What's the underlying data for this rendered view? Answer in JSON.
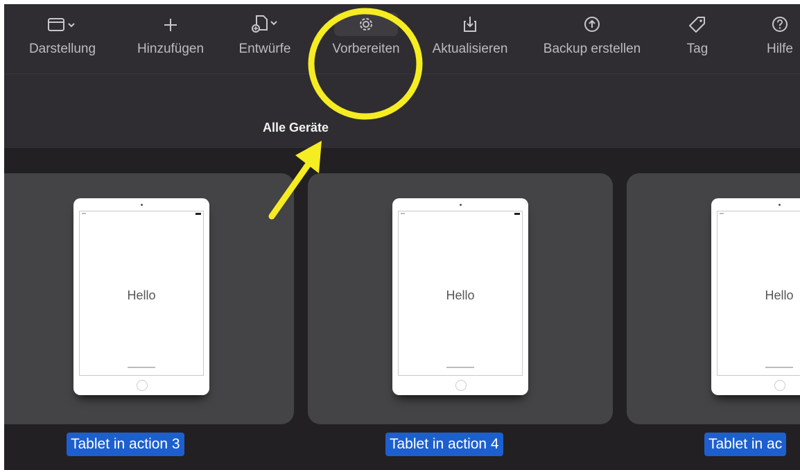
{
  "toolbar": {
    "items": [
      {
        "label": "Darstellung",
        "icon": "window-icon",
        "chevron": true
      },
      {
        "label": "Hinzufügen",
        "icon": "plus-icon",
        "chevron": false
      },
      {
        "label": "Entwürfe",
        "icon": "document-add-icon",
        "chevron": true
      },
      {
        "label": "Vorbereiten",
        "icon": "gear-icon",
        "chevron": false,
        "active": true
      },
      {
        "label": "Aktualisieren",
        "icon": "download-tray-icon",
        "chevron": false
      },
      {
        "label": "Backup erstellen",
        "icon": "upload-circle-icon",
        "chevron": false
      },
      {
        "label": "Tag",
        "icon": "tag-icon",
        "chevron": false
      },
      {
        "label": "Hilfe",
        "icon": "help-circle-icon",
        "chevron": false
      }
    ]
  },
  "section": {
    "title": "Alle Geräte"
  },
  "devices": [
    {
      "label": "Tablet in action 3",
      "screen_text": "Hello"
    },
    {
      "label": "Tablet in action 4",
      "screen_text": "Hello"
    },
    {
      "label": "Tablet in ac",
      "screen_text": "Hello"
    }
  ],
  "annotation": {
    "circle_color": "#f5ec22",
    "arrow_color": "#f5ec22"
  },
  "colors": {
    "window_bg": "#222023",
    "toolbar_bg": "#2f2d31",
    "tile_bg": "#444345",
    "selection": "#1d5fcf"
  }
}
